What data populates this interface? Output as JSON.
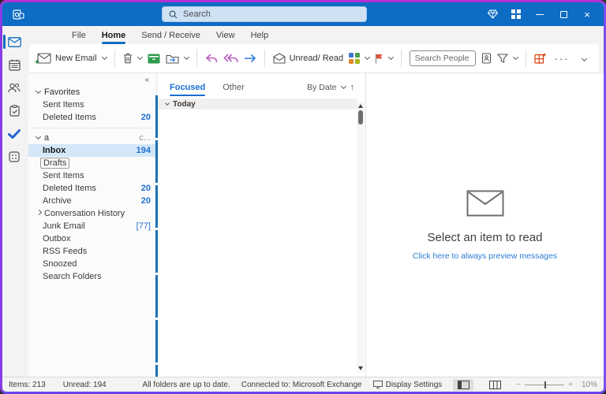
{
  "titlebar": {
    "search_placeholder": "Search"
  },
  "tabs": {
    "items": [
      "File",
      "Home",
      "Send / Receive",
      "View",
      "Help"
    ],
    "active": "Home"
  },
  "toolbar": {
    "new_email": "New Email",
    "unread_read": "Unread/ Read",
    "search_people_placeholder": "Search People",
    "more": "···"
  },
  "icons": {
    "collapse_pane": "«",
    "sort_asc": "↑"
  },
  "folders": {
    "favorites_label": "Favorites",
    "account_label": "a",
    "account_status": "c...",
    "favorites": [
      {
        "name": "Sent Items",
        "count": ""
      },
      {
        "name": "Deleted Items",
        "count": "20"
      }
    ],
    "items": [
      {
        "name": "Inbox",
        "count": "194"
      },
      {
        "name": "Drafts",
        "count": ""
      },
      {
        "name": "Sent Items",
        "count": ""
      },
      {
        "name": "Deleted Items",
        "count": "20"
      },
      {
        "name": "Archive",
        "count": "20"
      },
      {
        "name": "Conversation History",
        "count": ""
      },
      {
        "name": "Junk Email",
        "count": "[77]"
      },
      {
        "name": "Outbox",
        "count": ""
      },
      {
        "name": "RSS Feeds",
        "count": ""
      },
      {
        "name": "Snoozed",
        "count": ""
      },
      {
        "name": "Search Folders",
        "count": ""
      }
    ]
  },
  "message_list": {
    "tab_focused": "Focused",
    "tab_other": "Other",
    "sort_label": "By Date",
    "group_today": "Today"
  },
  "reading_pane": {
    "empty_title": "Select an item to read",
    "empty_link": "Click here to always preview messages"
  },
  "statusbar": {
    "items": "Items: 213",
    "unread": "Unread: 194",
    "sync": "All folders are up to date.",
    "connection": "Connected to: Microsoft Exchange",
    "display_settings": "Display Settings",
    "zoom": "10%"
  },
  "colors": {
    "titlebar_blue": "#0d6cc4",
    "accent_blue": "#0f6cbd",
    "count_blue": "#1f6fd0",
    "selected_row": "#d3e7f8",
    "pane_divider_blue": "#1e6fb0",
    "flag_red": "#e0523f",
    "frame_purple": "#8a3de6"
  }
}
